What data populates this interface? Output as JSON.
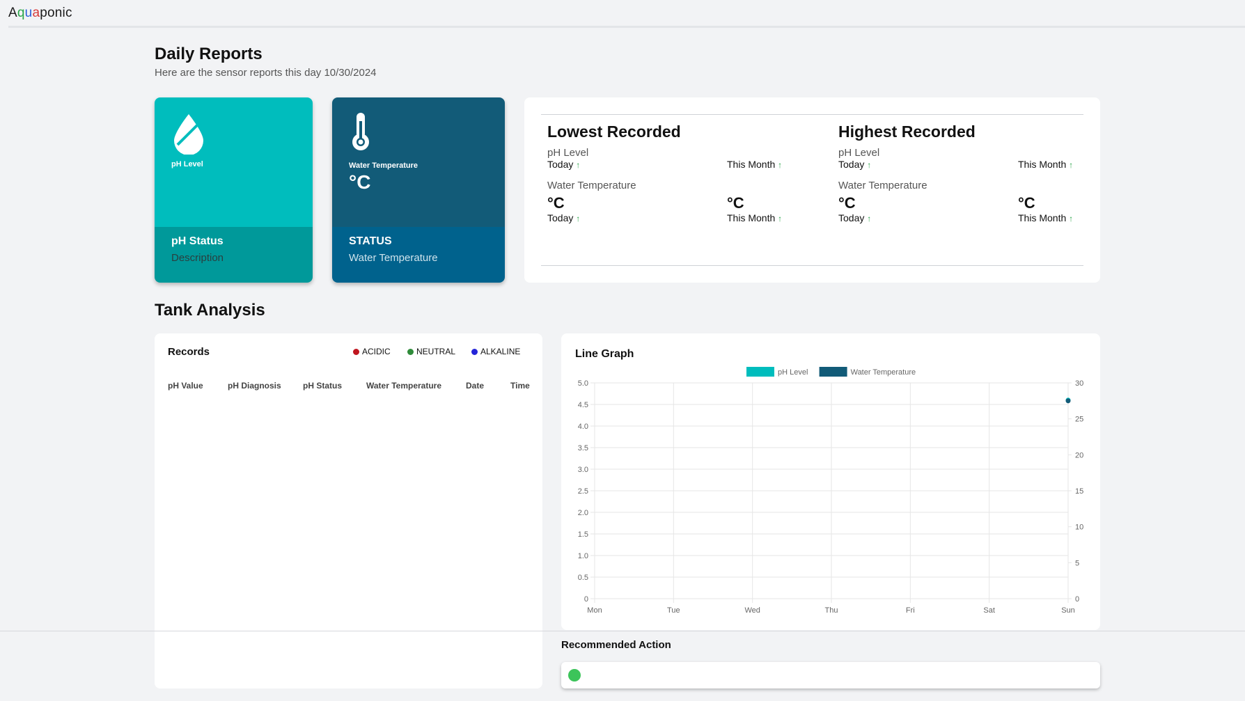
{
  "app": {
    "brand_parts": [
      {
        "text": "A",
        "color": "#1a1a1a"
      },
      {
        "text": "q",
        "color": "#2aa54a"
      },
      {
        "text": "u",
        "color": "#2b5fd9"
      },
      {
        "text": "a",
        "color": "#d83a3a"
      },
      {
        "text": "ponic",
        "color": "#1a1a1a"
      }
    ]
  },
  "daily": {
    "title": "Daily Reports",
    "subtitle": "Here are the sensor reports this day 10/30/2024"
  },
  "cards": {
    "ph": {
      "label": "pH Level",
      "status_title": "pH Status",
      "status_desc": "Description",
      "icon": "water-drop-icon"
    },
    "temp": {
      "label": "Water Temperature",
      "unit": "°C",
      "status_title": "STATUS",
      "status_desc": "Water Temperature",
      "icon": "thermometer-icon"
    }
  },
  "recorded": {
    "lowest": {
      "title": "Lowest Recorded",
      "ph_label": "pH Level",
      "today": "Today",
      "this_month": "This Month",
      "temp_label": "Water Temperature",
      "temp_today": "°C",
      "temp_month": "°C",
      "arrow": "↑"
    },
    "highest": {
      "title": "Highest Recorded",
      "ph_label": "pH Level",
      "today": "Today",
      "this_month": "This Month",
      "temp_label": "Water Temperature",
      "temp_today": "°C",
      "temp_month": "°C",
      "arrow": "↑"
    }
  },
  "tank": {
    "title": "Tank Analysis",
    "records": {
      "title": "Records",
      "legend": [
        {
          "label": "ACIDIC",
          "color": "#c0161f"
        },
        {
          "label": "NEUTRAL",
          "color": "#2f8b3a"
        },
        {
          "label": "ALKALINE",
          "color": "#2424d8"
        }
      ],
      "columns": [
        "pH Value",
        "pH Diagnosis",
        "pH Status",
        "Water Temperature",
        "Date",
        "Time"
      ]
    }
  },
  "chart_data": {
    "type": "line",
    "title": "Line Graph",
    "categories": [
      "Mon",
      "Tue",
      "Wed",
      "Thu",
      "Fri",
      "Sat",
      "Sun"
    ],
    "series": [
      {
        "name": "pH Level",
        "color": "#00bdbd",
        "axis": "left",
        "values": [
          null,
          null,
          null,
          null,
          null,
          null,
          4.6
        ]
      },
      {
        "name": "Water Temperature",
        "color": "#125b78",
        "axis": "right",
        "values": [
          null,
          null,
          null,
          null,
          null,
          null,
          27.5
        ]
      }
    ],
    "y_left": {
      "ylim": [
        0,
        5.0
      ],
      "ticks": [
        "5.0",
        "4.5",
        "4.0",
        "3.5",
        "3.0",
        "2.5",
        "2.0",
        "1.5",
        "1.0",
        "0.5",
        "0"
      ]
    },
    "y_right": {
      "ylim": [
        0,
        30
      ],
      "ticks": [
        "30",
        "25",
        "20",
        "15",
        "10",
        "5",
        "0"
      ]
    },
    "grid": true,
    "legend_position": "top"
  },
  "recommended": {
    "title": "Recommended Action",
    "status_color": "#3cc45a"
  }
}
